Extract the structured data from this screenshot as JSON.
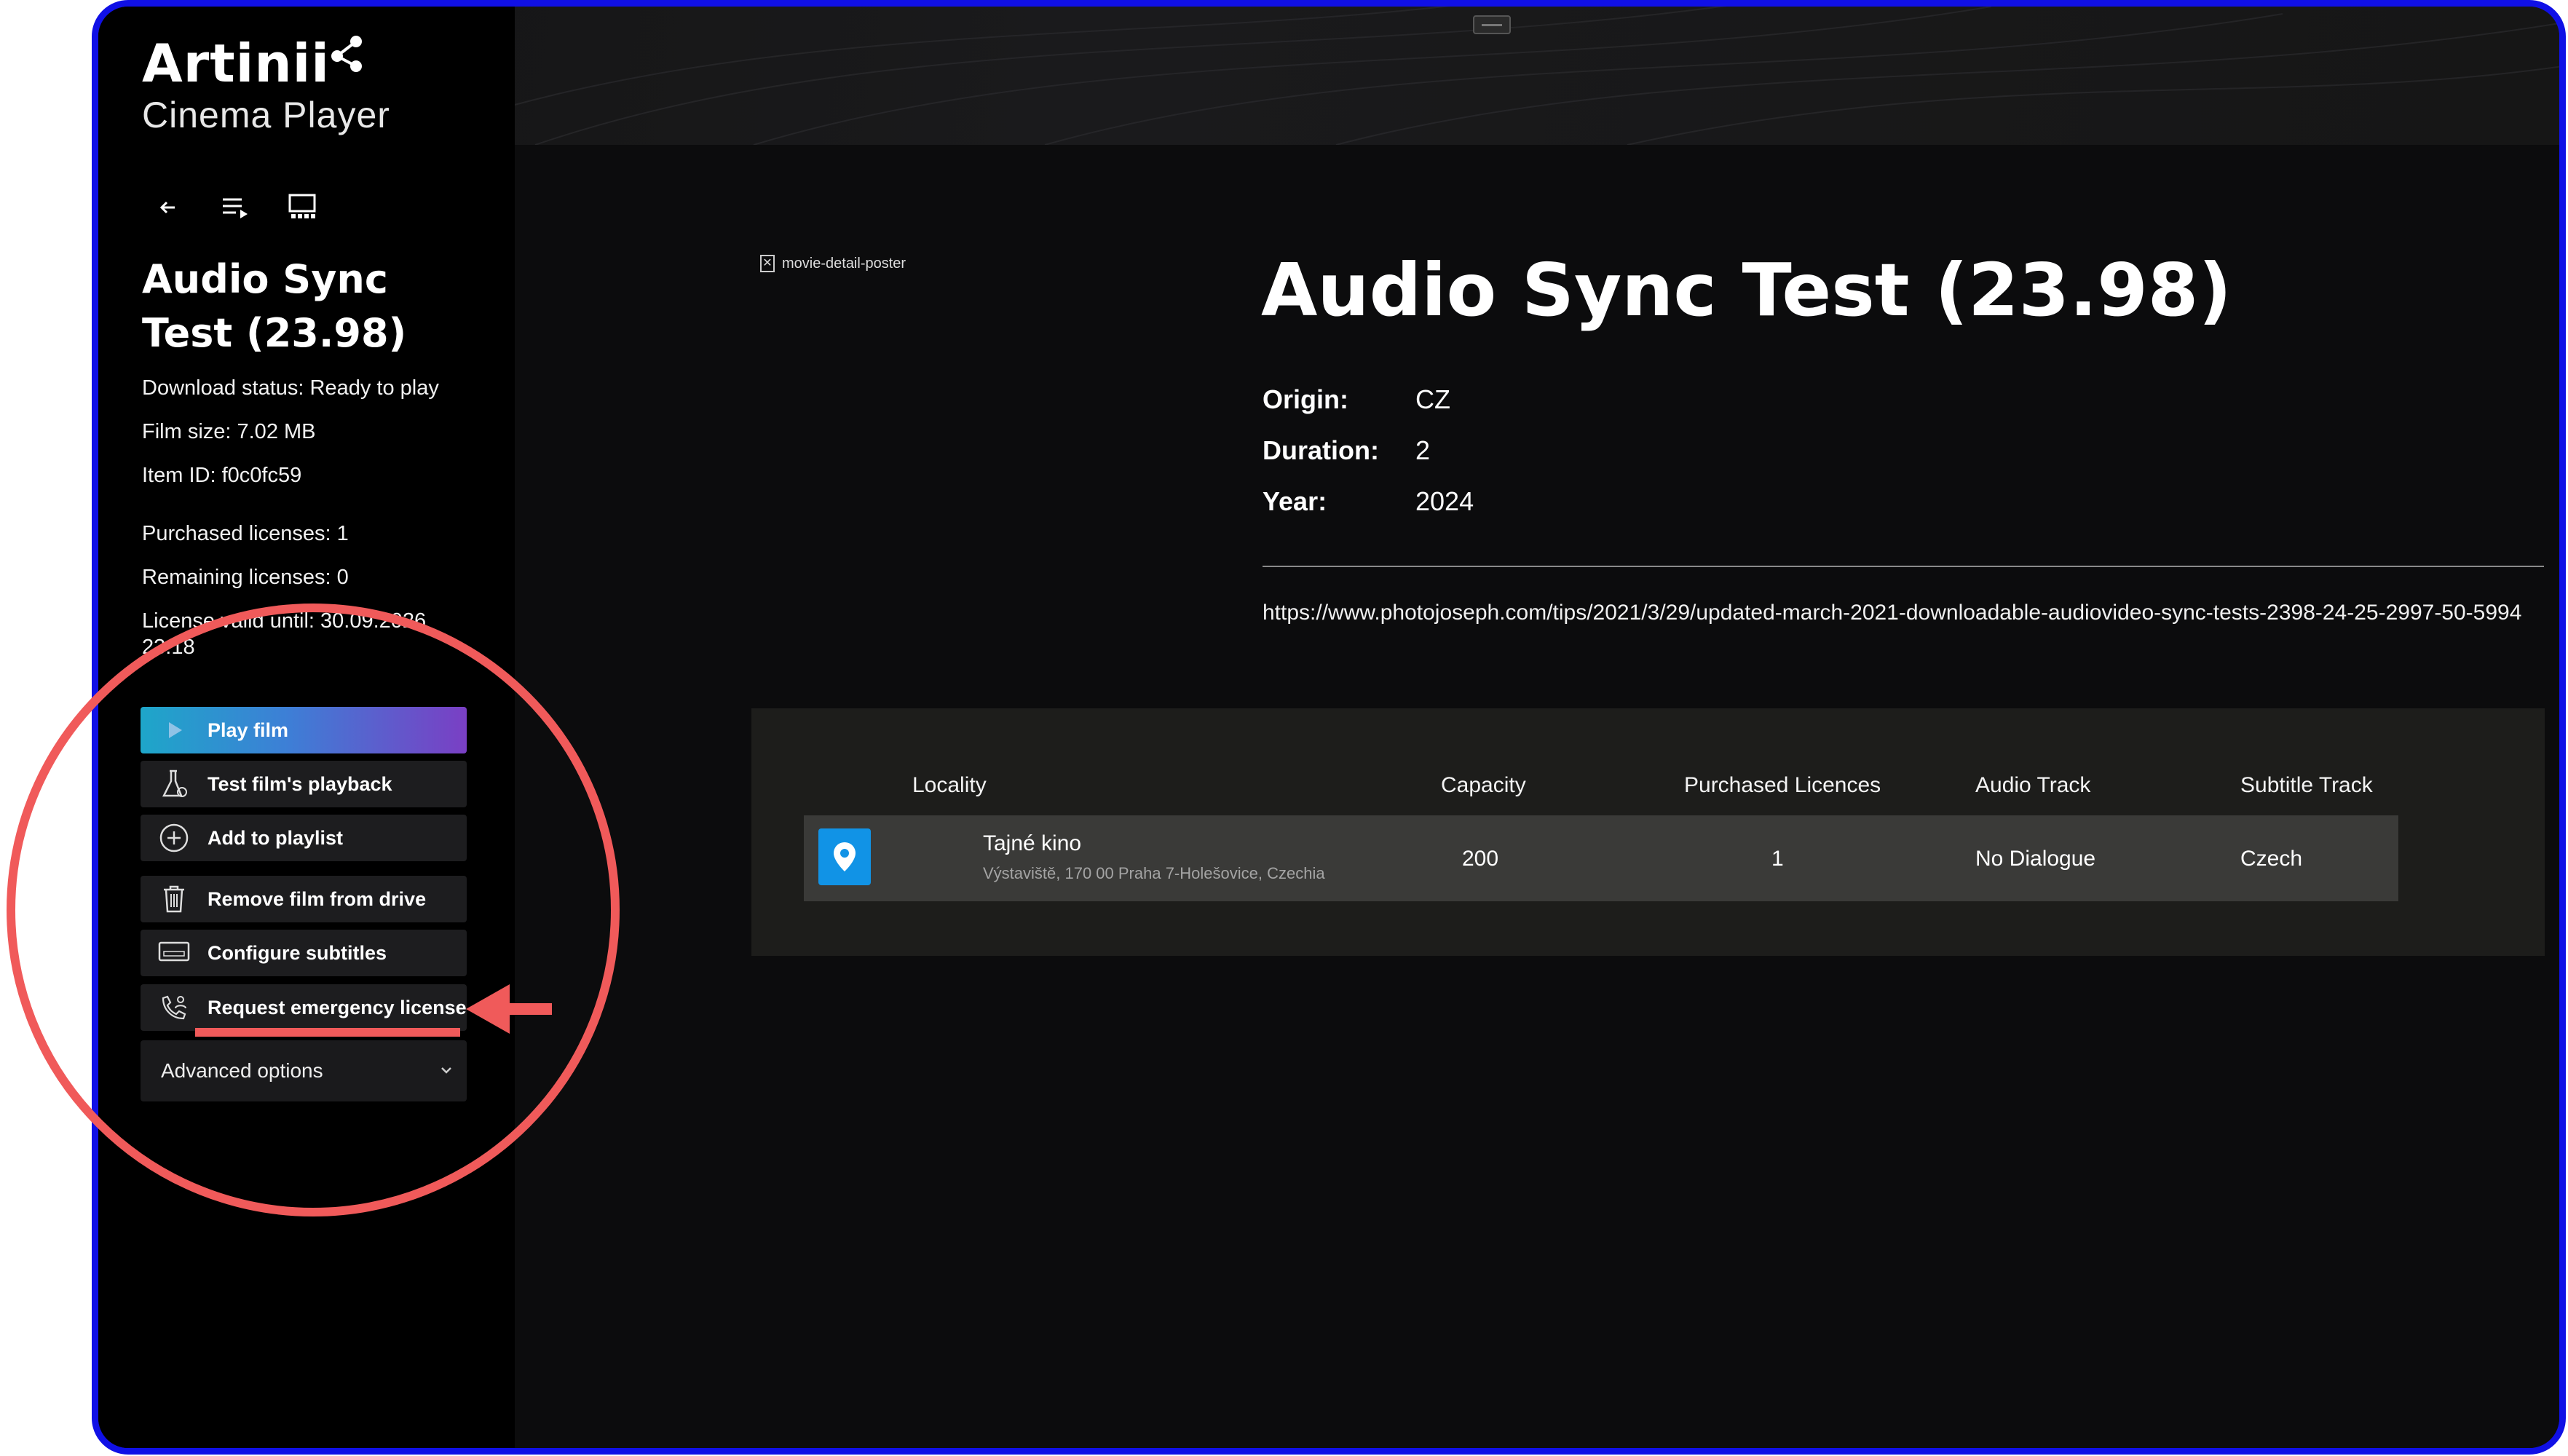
{
  "app": {
    "logo_text": "Artinii",
    "logo_subtitle": "Cinema Player"
  },
  "nav": {
    "icons": [
      "back-arrow-icon",
      "playlist-icon",
      "cinema-screen-icon"
    ]
  },
  "sidebar": {
    "title": "Audio Sync Test (23.98)",
    "download_status": "Download status: Ready to play",
    "film_size": "Film size: 7.02 MB",
    "item_id": "Item ID: f0c0fc59",
    "purchased_licenses": "Purchased licenses: 1",
    "remaining_licenses": "Remaining licenses: 0",
    "license_valid": "License valid until: 30.09.2026 23:18",
    "buttons": {
      "play": "Play film",
      "test": "Test film's playback",
      "playlist": "Add to playlist",
      "remove": "Remove film from drive",
      "subtitles": "Configure subtitles",
      "emergency": "Request emergency license"
    },
    "advanced": "Advanced options"
  },
  "movie": {
    "poster_alt": "movie-detail-poster",
    "title": "Audio Sync Test (23.98)",
    "origin_label": "Origin:",
    "origin": "CZ",
    "duration_label": "Duration:",
    "duration": "2",
    "year_label": "Year:",
    "year": "2024",
    "link": "https://www.photojoseph.com/tips/2021/3/29/updated-march-2021-downloadable-audiovideo-sync-tests-2398-24-25-2997-50-5994"
  },
  "table": {
    "headers": {
      "locality": "Locality",
      "capacity": "Capacity",
      "purchased": "Purchased Licences",
      "audio": "Audio Track",
      "subtitle": "Subtitle Track"
    },
    "rows": [
      {
        "name": "Tajné kino",
        "address": "Výstaviště, 170 00 Praha 7-Holešovice, Czechia",
        "capacity": "200",
        "purchased": "1",
        "audio": "No Dialogue",
        "subtitle": "Czech"
      }
    ]
  },
  "colors": {
    "frame": "#1010e6",
    "annotation": "#f05a5a",
    "play_gradient_start": "#1ea6c9",
    "play_gradient_end": "#7a3fc4",
    "pin": "#1193e6"
  }
}
